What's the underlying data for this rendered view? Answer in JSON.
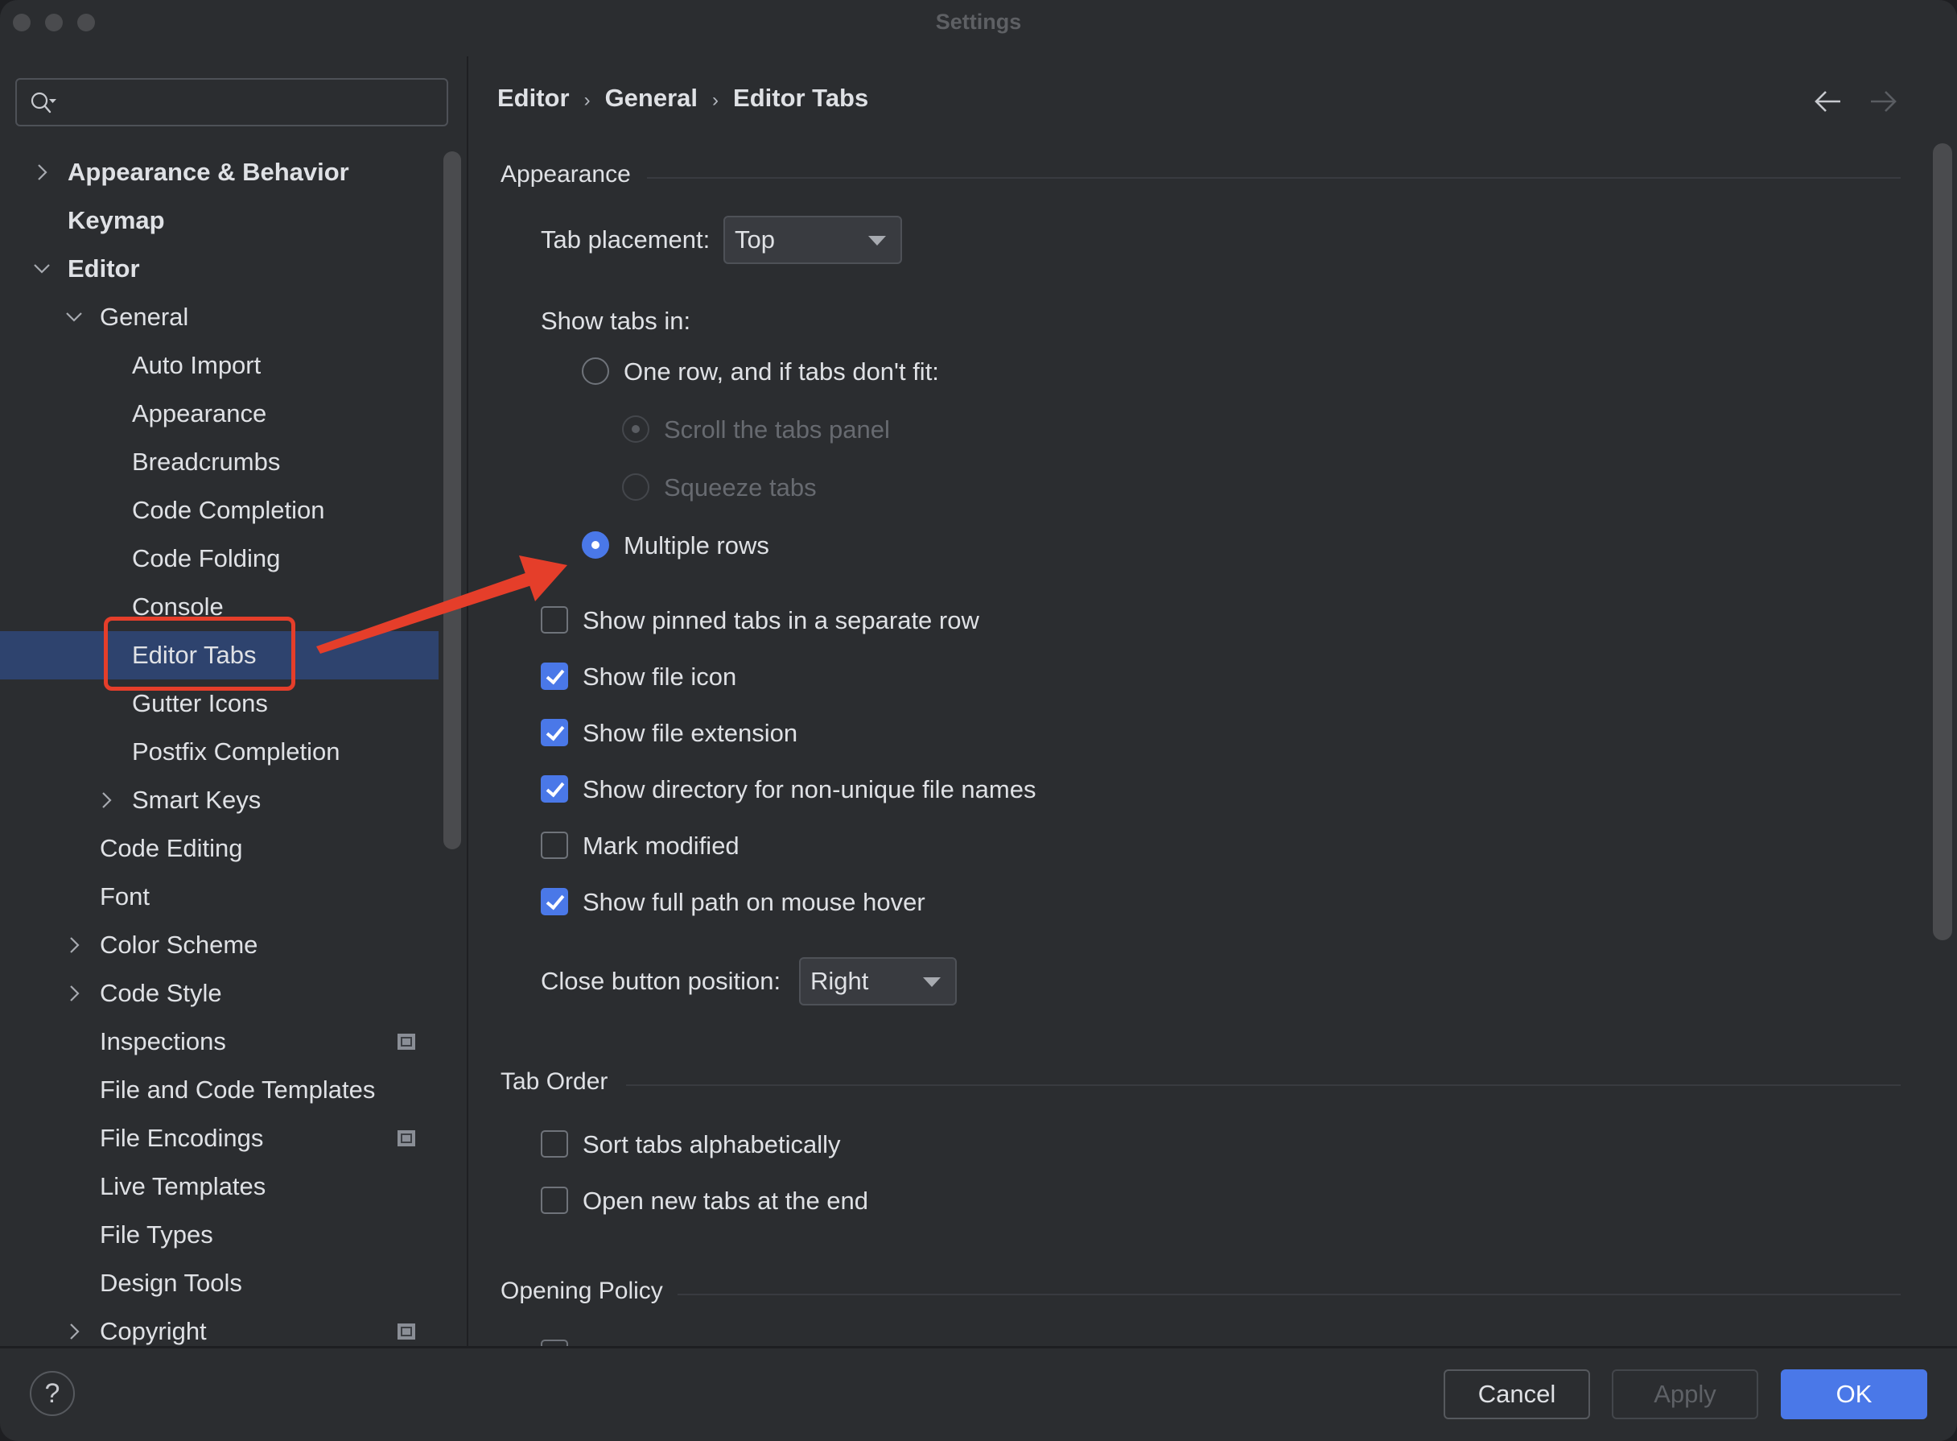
{
  "window": {
    "title": "Settings"
  },
  "search": {
    "placeholder": "",
    "value": ""
  },
  "sidebar": {
    "items": [
      {
        "label": "Appearance & Behavior",
        "level": 0,
        "bold": true,
        "expander": "collapsed"
      },
      {
        "label": "Keymap",
        "level": 0,
        "bold": true,
        "expander": "none"
      },
      {
        "label": "Editor",
        "level": 0,
        "bold": true,
        "expander": "expanded"
      },
      {
        "label": "General",
        "level": 1,
        "bold": false,
        "expander": "expanded"
      },
      {
        "label": "Auto Import",
        "level": 2,
        "bold": false,
        "expander": "none"
      },
      {
        "label": "Appearance",
        "level": 2,
        "bold": false,
        "expander": "none"
      },
      {
        "label": "Breadcrumbs",
        "level": 2,
        "bold": false,
        "expander": "none"
      },
      {
        "label": "Code Completion",
        "level": 2,
        "bold": false,
        "expander": "none"
      },
      {
        "label": "Code Folding",
        "level": 2,
        "bold": false,
        "expander": "none"
      },
      {
        "label": "Console",
        "level": 2,
        "bold": false,
        "expander": "none"
      },
      {
        "label": "Editor Tabs",
        "level": 2,
        "bold": false,
        "expander": "none",
        "selected": true
      },
      {
        "label": "Gutter Icons",
        "level": 2,
        "bold": false,
        "expander": "none"
      },
      {
        "label": "Postfix Completion",
        "level": 2,
        "bold": false,
        "expander": "none"
      },
      {
        "label": "Smart Keys",
        "level": 2,
        "bold": false,
        "expander": "collapsed"
      },
      {
        "label": "Code Editing",
        "level": 1,
        "bold": false,
        "expander": "none"
      },
      {
        "label": "Font",
        "level": 1,
        "bold": false,
        "expander": "none"
      },
      {
        "label": "Color Scheme",
        "level": 1,
        "bold": false,
        "expander": "collapsed"
      },
      {
        "label": "Code Style",
        "level": 1,
        "bold": false,
        "expander": "collapsed"
      },
      {
        "label": "Inspections",
        "level": 1,
        "bold": false,
        "expander": "none",
        "project_badge": true
      },
      {
        "label": "File and Code Templates",
        "level": 1,
        "bold": false,
        "expander": "none"
      },
      {
        "label": "File Encodings",
        "level": 1,
        "bold": false,
        "expander": "none",
        "project_badge": true
      },
      {
        "label": "Live Templates",
        "level": 1,
        "bold": false,
        "expander": "none"
      },
      {
        "label": "File Types",
        "level": 1,
        "bold": false,
        "expander": "none"
      },
      {
        "label": "Design Tools",
        "level": 1,
        "bold": false,
        "expander": "none"
      },
      {
        "label": "Copyright",
        "level": 1,
        "bold": false,
        "expander": "collapsed",
        "project_badge": true
      }
    ]
  },
  "breadcrumb": {
    "items": [
      "Editor",
      "General",
      "Editor Tabs"
    ],
    "separator": "›"
  },
  "nav": {
    "back_icon": "arrow-left-icon",
    "forward_icon": "arrow-right-icon",
    "forward_enabled": false
  },
  "sections": {
    "appearance": {
      "title": "Appearance",
      "tab_placement_label": "Tab placement:",
      "tab_placement_value": "Top",
      "show_tabs_in_label": "Show tabs in:",
      "radios": [
        {
          "label": "One row, and if tabs don't fit:",
          "checked": false,
          "enabled": true
        },
        {
          "label": "Scroll the tabs panel",
          "checked": true,
          "enabled": false
        },
        {
          "label": "Squeeze tabs",
          "checked": false,
          "enabled": false
        },
        {
          "label": "Multiple rows",
          "checked": true,
          "enabled": true
        }
      ],
      "checkboxes": [
        {
          "label": "Show pinned tabs in a separate row",
          "checked": false
        },
        {
          "label": "Show file icon",
          "checked": true
        },
        {
          "label": "Show file extension",
          "checked": true
        },
        {
          "label": "Show directory for non-unique file names",
          "checked": true
        },
        {
          "label": "Mark modified",
          "checked": false
        },
        {
          "label": "Show full path on mouse hover",
          "checked": true
        }
      ],
      "close_button_label": "Close button position:",
      "close_button_value": "Right"
    },
    "tab_order": {
      "title": "Tab Order",
      "checkboxes": [
        {
          "label": "Sort tabs alphabetically",
          "checked": false
        },
        {
          "label": "Open new tabs at the end",
          "checked": false
        }
      ]
    },
    "opening_policy": {
      "title": "Opening Policy"
    }
  },
  "footer": {
    "help_label": "?",
    "cancel_label": "Cancel",
    "apply_label": "Apply",
    "ok_label": "OK"
  },
  "colors": {
    "accent": "#4a78e8",
    "selection": "#2e436e",
    "annotation": "#e53e2a",
    "background": "#2b2d30"
  }
}
